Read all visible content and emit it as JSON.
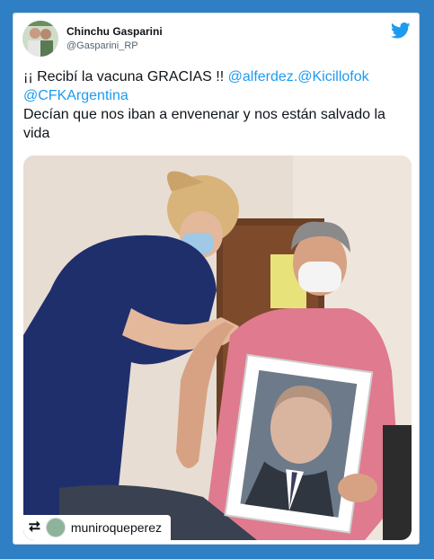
{
  "author": {
    "display_name": "Chinchu Gasparini",
    "handle": "@Gasparini_RP"
  },
  "tweet": {
    "text_part1": "¡¡ Recibí la vacuna GRACIAS !! ",
    "mention1": "@alferdez",
    "mention2": ".@Kicillofok",
    "mention3": "@CFKArgentina",
    "text_part2": "Decían que nos iban a envenenar y nos están salvado la vida"
  },
  "media": {
    "repost_user": "muniroqueperez"
  },
  "colors": {
    "background": "#2e7fc4",
    "link": "#1d9bf0",
    "twitter_blue": "#1d9bf0"
  },
  "icons": {
    "brand": "twitter-bird-icon",
    "repost": "retweet-icon"
  }
}
